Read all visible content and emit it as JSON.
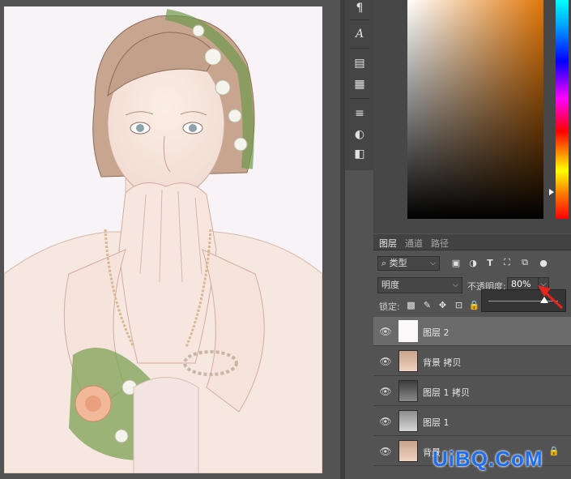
{
  "toolstrip": {
    "icons": [
      "paragraph-icon",
      "character-icon",
      "properties-icon",
      "notes-icon",
      "adjustments-icon",
      "mask-icon",
      "swatch-icon"
    ]
  },
  "color_panel": {
    "base_hue": "#e0770a"
  },
  "layers_panel": {
    "tabs": [
      {
        "label": "图层",
        "active": true
      },
      {
        "label": "通道",
        "active": false
      },
      {
        "label": "路径",
        "active": false
      }
    ],
    "filter": {
      "label": "类型"
    },
    "blend_mode": "明度",
    "opacity": {
      "label": "不透明度:",
      "value": "80%",
      "fraction": 0.8
    },
    "lock": {
      "label": "锁定:"
    },
    "layers": [
      {
        "name": "图层 2",
        "visible": true,
        "selected": true
      },
      {
        "name": "背景 拷贝",
        "visible": true,
        "selected": false
      },
      {
        "name": "图层 1 拷贝",
        "visible": true,
        "selected": false
      },
      {
        "name": "图层 1",
        "visible": true,
        "selected": false
      },
      {
        "name": "背景",
        "visible": true,
        "selected": false,
        "locked": true
      }
    ]
  },
  "watermark": "UiBQ.CoM",
  "accent": "#1e6ff0",
  "arrow_color": "#e8241c"
}
